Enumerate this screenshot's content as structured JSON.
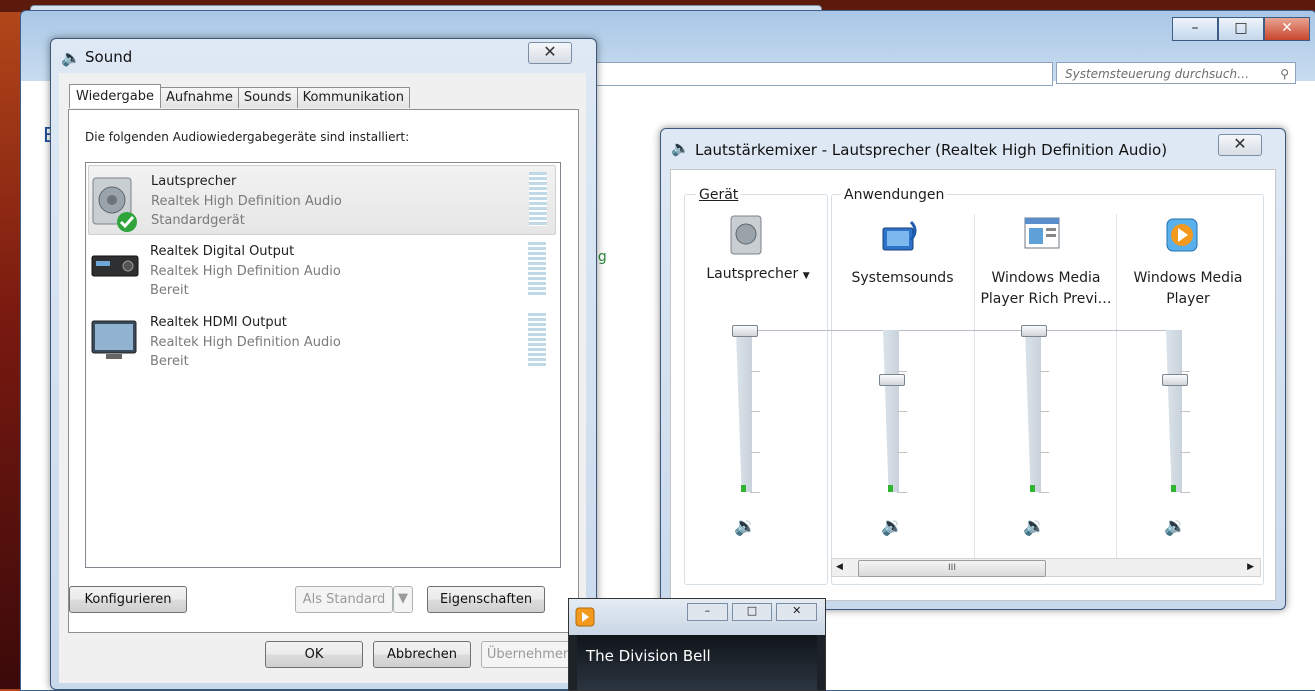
{
  "explorer": {
    "search_placeholder": "Systemsteuerung durchsuch…",
    "green_text": "ng",
    "left_letter": "E"
  },
  "sound": {
    "title": "Sound",
    "tabs": [
      {
        "label": "Wiedergabe"
      },
      {
        "label": "Aufnahme"
      },
      {
        "label": "Sounds"
      },
      {
        "label": "Kommunikation"
      }
    ],
    "intro": "Die folgenden Audiowiedergabegeräte sind installiert:",
    "devices": [
      {
        "name": "Lautsprecher",
        "driver": "Realtek High Definition Audio",
        "status": "Standardgerät"
      },
      {
        "name": "Realtek Digital Output",
        "driver": "Realtek High Definition Audio",
        "status": "Bereit"
      },
      {
        "name": "Realtek HDMI Output",
        "driver": "Realtek High Definition Audio",
        "status": "Bereit"
      }
    ],
    "buttons": {
      "configure": "Konfigurieren",
      "set_default": "Als Standard",
      "properties": "Eigenschaften",
      "ok": "OK",
      "cancel": "Abbrechen",
      "apply": "Übernehmen"
    }
  },
  "mixer": {
    "title": "Lautstärkemixer - Lautsprecher (Realtek High Definition Audio)",
    "device_group": "Gerät",
    "apps_group": "Anwendungen",
    "channels": [
      {
        "label": "Lautsprecher",
        "level": 1.0
      },
      {
        "label": "Systemsounds",
        "level": 0.7
      },
      {
        "label": "Windows Media Player Rich Previ…",
        "level": 1.0
      },
      {
        "label": "Windows Media Player",
        "level": 0.7
      }
    ],
    "scroll_grip": "III"
  },
  "mini_player": {
    "track": "The Division Bell"
  },
  "colors": {
    "accent": "#1664c8",
    "peak": "#2fb52f"
  }
}
